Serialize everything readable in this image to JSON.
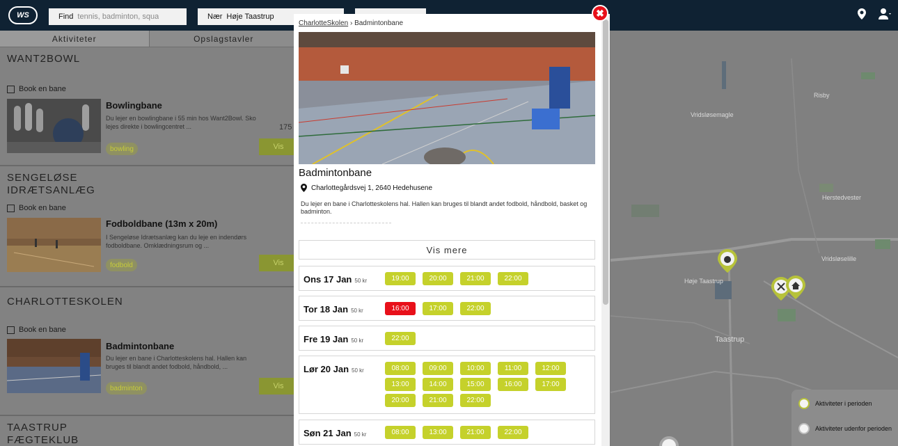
{
  "header": {
    "logo": "WS",
    "search_label": "Find",
    "search_placeholder": "tennis, badminton, squa",
    "near_label": "Nær",
    "near_value": "Høje Taastrup"
  },
  "tabs": [
    "Aktiviteter",
    "Opslagstavler"
  ],
  "venues": [
    {
      "name": "WANT2BOWL",
      "book": "Book en bane",
      "activity": "Bowlingbane",
      "desc": "Du lejer en bowlingbane i 55 min hos Want2Bowl. Sko lejes direkte i bowlingcentret ...",
      "tag": "bowling",
      "price": "175",
      "button": "Vis"
    },
    {
      "name": "SENGELØSE IDRÆTSANLÆG",
      "book": "Book en bane",
      "activity": "Fodboldbane (13m x 20m)",
      "desc": "I Sengeløse Idrætsanlæg kan du leje en indendørs fodboldbane. Omklædningsrum og ...",
      "tag": "fodbold",
      "button": "Vis"
    },
    {
      "name": "CHARLOTTESKOLEN",
      "book": "Book en bane",
      "activity": "Badmintonbane",
      "desc": "Du lejer en bane i Charlotteskolens hal. Hallen kan bruges til blandt andet fodbold, håndbold, ...",
      "tag": "badminton",
      "button": "Vis"
    },
    {
      "name": "TAASTRUP FÆGTEKLUB"
    }
  ],
  "map": {
    "labels": [
      "Risby",
      "Vridsløsemagle",
      "Herstedvester",
      "Vridsløselille",
      "Høje Taastrup",
      "Taastrup"
    ],
    "legend": [
      "Aktiviteter i perioden",
      "Aktiviteter udenfor perioden"
    ]
  },
  "modal": {
    "crumb_parent": "CharlotteSkolen",
    "crumb_sep": "›",
    "crumb_current": "Badmintonbane",
    "title": "Badmintonbane",
    "address": "Charlottegårdsvej 1, 2640 Hedehusene",
    "description": "Du lejer en bane i Charlotteskolens hal. Hallen kan bruges til blandt andet fodbold, håndbold, basket og badminton.",
    "more_button": "Vis mere",
    "close": "✖",
    "days": [
      {
        "label": "Ons 17 Jan",
        "price": "50 kr",
        "slots": [
          "19:00",
          "20:00",
          "21:00",
          "22:00"
        ],
        "busy": []
      },
      {
        "label": "Tor 18 Jan",
        "price": "50 kr",
        "slots": [
          "16:00",
          "17:00",
          "22:00"
        ],
        "busy": [
          "16:00"
        ]
      },
      {
        "label": "Fre 19 Jan",
        "price": "50 kr",
        "slots": [
          "22:00"
        ],
        "busy": []
      },
      {
        "label": "Lør 20 Jan",
        "price": "50 kr",
        "slots": [
          "08:00",
          "09:00",
          "10:00",
          "11:00",
          "12:00",
          "13:00",
          "14:00",
          "15:00",
          "16:00",
          "17:00",
          "20:00",
          "21:00",
          "22:00"
        ],
        "busy": []
      },
      {
        "label": "Søn 21 Jan",
        "price": "50 kr",
        "slots": [
          "08:00",
          "13:00",
          "21:00",
          "22:00"
        ],
        "busy": []
      }
    ]
  },
  "colors": {
    "accent": "#c5d12b",
    "busy": "#e8101a",
    "topbar": "#0f2233"
  }
}
